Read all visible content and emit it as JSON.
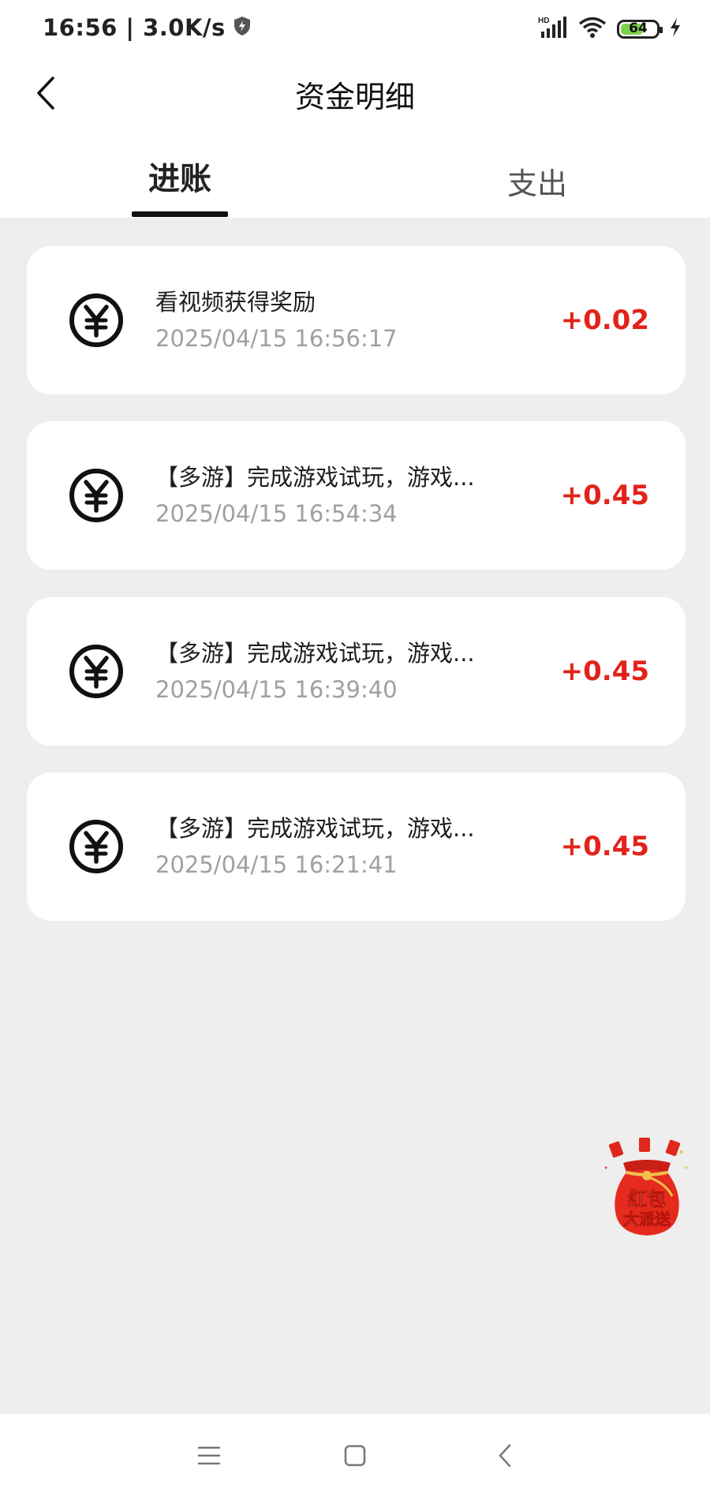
{
  "status_bar": {
    "time": "16:56 | 3.0K/s",
    "network": "HD",
    "battery": "64",
    "battery_level_percent": 64
  },
  "header": {
    "title": "资金明细"
  },
  "tabs": [
    {
      "label": "进账",
      "active": true
    },
    {
      "label": "支出",
      "active": false
    }
  ],
  "transactions": [
    {
      "title": "看视频获得奖励",
      "time": "2025/04/15 16:56:17",
      "amount": "+0.02"
    },
    {
      "title": "【多游】完成游戏试玩，游戏...",
      "time": "2025/04/15 16:54:34",
      "amount": "+0.45"
    },
    {
      "title": "【多游】完成游戏试玩，游戏...",
      "time": "2025/04/15 16:39:40",
      "amount": "+0.45"
    },
    {
      "title": "【多游】完成游戏试玩，游戏...",
      "time": "2025/04/15 16:21:41",
      "amount": "+0.45"
    }
  ],
  "float_button": {
    "line1": "红包",
    "line2": "大派送"
  },
  "icons": {
    "transaction": "yen-coin-icon",
    "back": "chevron-left-icon"
  },
  "colors": {
    "amount": "#e2231a",
    "background": "#eeeeee",
    "card": "#ffffff",
    "battery_fill": "#7ed14b"
  }
}
